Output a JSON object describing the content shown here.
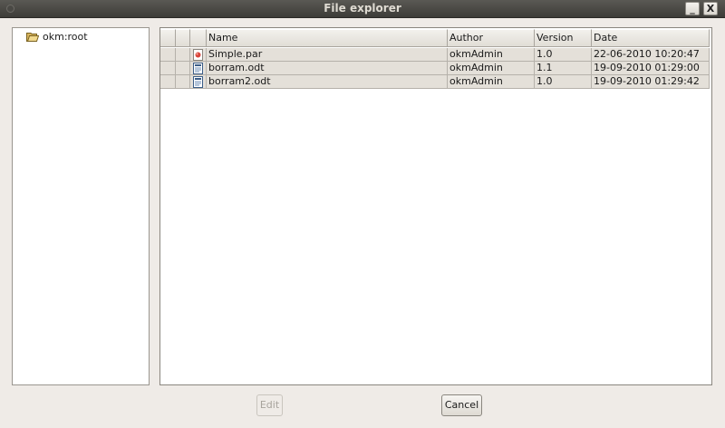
{
  "window": {
    "title": "File explorer",
    "controls": {
      "minimize": "_",
      "close": "X"
    }
  },
  "tree": {
    "items": [
      {
        "label": "okm:root",
        "icon": "folder-open-icon"
      }
    ]
  },
  "table": {
    "columns": [
      "",
      "",
      "",
      "Name",
      "Author",
      "Version",
      "Date"
    ],
    "rows": [
      {
        "icon": "par-file-icon",
        "name": "Simple.par",
        "author": "okmAdmin",
        "version": "1.0",
        "date": "22-06-2010 10:20:47"
      },
      {
        "icon": "odt-document-icon",
        "name": "borram.odt",
        "author": "okmAdmin",
        "version": "1.1",
        "date": "19-09-2010 01:29:00"
      },
      {
        "icon": "odt-document-icon",
        "name": "borram2.odt",
        "author": "okmAdmin",
        "version": "1.0",
        "date": "19-09-2010 01:29:42"
      }
    ]
  },
  "buttons": {
    "edit": "Edit",
    "cancel": "Cancel"
  },
  "colors": {
    "titlebar": "#3d3c38",
    "row_selected_bg": "#e4e0d9",
    "dialog_bg": "#efebe7"
  }
}
